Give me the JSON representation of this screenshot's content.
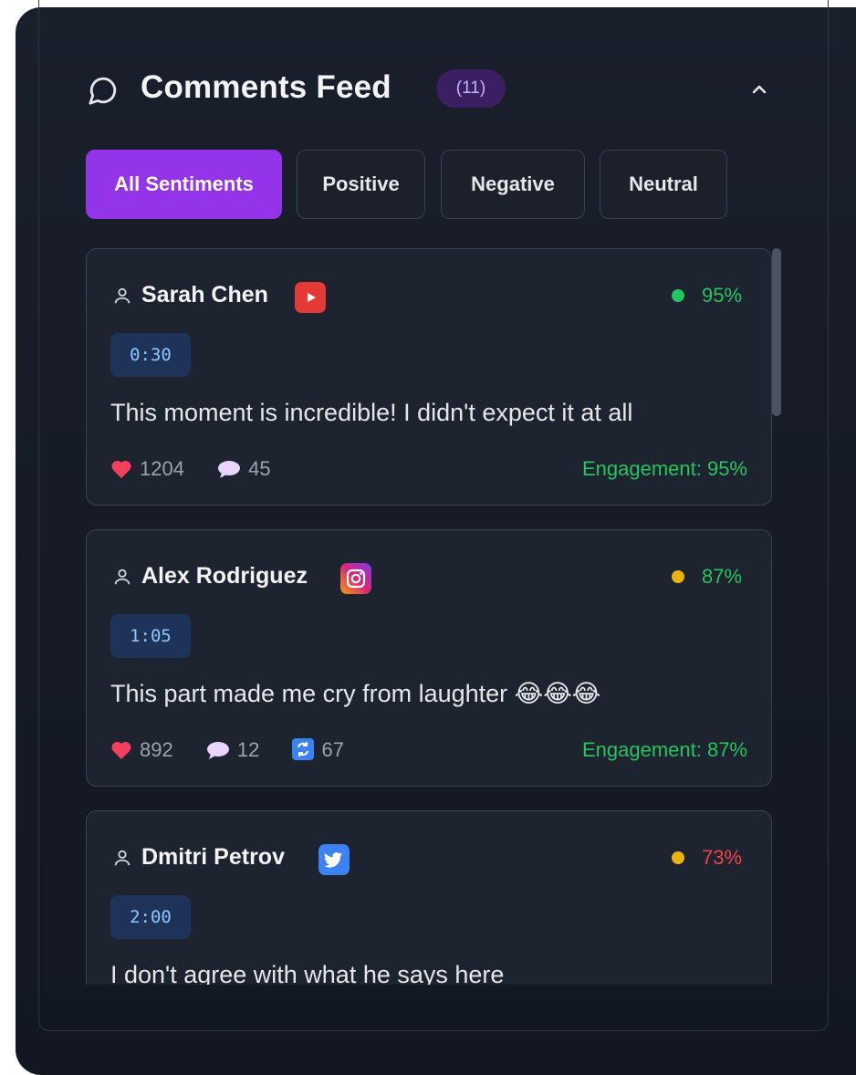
{
  "header": {
    "title": "Comments Feed",
    "count": "(11)"
  },
  "filters": [
    {
      "label": "All Sentiments",
      "active": true
    },
    {
      "label": "Positive",
      "active": false
    },
    {
      "label": "Negative",
      "active": false
    },
    {
      "label": "Neutral",
      "active": false
    }
  ],
  "comments": [
    {
      "user": "Sarah Chen",
      "platform": "youtube",
      "score": "95%",
      "score_color": "#22c55e",
      "dot_color": "#22c55e",
      "timestamp": "0:30",
      "text": "This moment is incredible! I didn't expect it at all",
      "likes": "1204",
      "replies": "45",
      "engagement": "Engagement: 95%"
    },
    {
      "user": "Alex Rodriguez",
      "platform": "instagram",
      "score": "87%",
      "score_color": "#22c55e",
      "dot_color": "#eab308",
      "timestamp": "1:05",
      "text": "This part made me cry from laughter 😂😂😂",
      "likes": "892",
      "replies": "12",
      "shares": "67",
      "engagement": "Engagement: 87%"
    },
    {
      "user": "Dmitri Petrov",
      "platform": "twitter",
      "score": "73%",
      "score_color": "#ef4444",
      "dot_color": "#eab308",
      "timestamp": "2:00",
      "text": "I don't agree with what he says here"
    }
  ]
}
